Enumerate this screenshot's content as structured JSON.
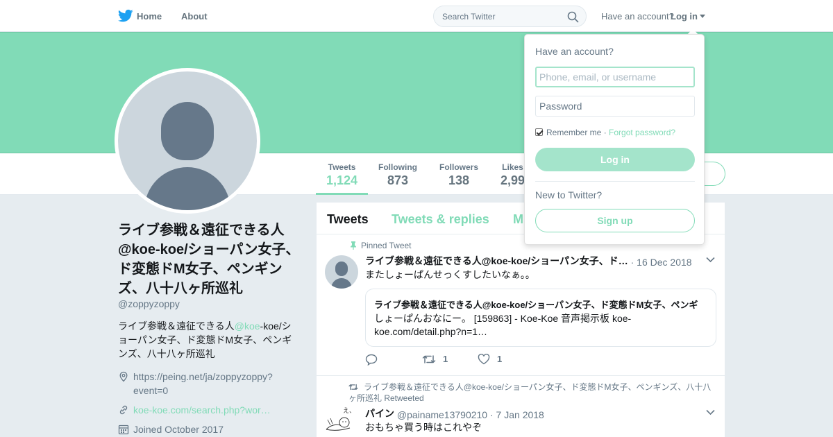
{
  "topnav": {
    "home_label": "Home",
    "about_label": "About",
    "search_placeholder": "Search Twitter",
    "have_account": "Have an account?",
    "login_label": "Log in"
  },
  "profile_nav": {
    "stats": [
      {
        "label": "Tweets",
        "value": "1,124"
      },
      {
        "label": "Following",
        "value": "873"
      },
      {
        "label": "Followers",
        "value": "138"
      },
      {
        "label": "Likes",
        "value": "2,99"
      }
    ]
  },
  "profile": {
    "name": "ライブ参戦＆遠征できる人@koe-koe/ショーパン女子、ド変態ドM女子、ペンギンズ、八十八ヶ所巡礼",
    "handle": "@zoppyzoppy",
    "bio_prefix": "ライブ参戦＆遠征できる人",
    "bio_mention": "@koe",
    "bio_suffix": "-koe/ショーパン女子、ド変態ドM女子、ペンギンズ、八十八ヶ所巡礼",
    "location": "https://peing.net/ja/zoppyzoppy?event=0",
    "website": "koe-koe.com/search.php?wor…",
    "joined": "Joined October 2017"
  },
  "timeline": {
    "tabs": [
      "Tweets",
      "Tweets & replies",
      "M"
    ],
    "pinned": {
      "pinned_label": "Pinned Tweet",
      "author": "ライブ参戦＆遠征できる人@koe-koe/ショーパン女子、ド…",
      "date": "· 16 Dec 2018",
      "text": "またしょーぱんせっくすしたいなぁ。。",
      "card_title": "ライブ参戦＆遠征できる人@koe-koe/ショーパン女子、ド変態ドM女子、ペンギ",
      "card_desc": "しょーぱんおなにー。 [159863] - Koe-Koe 音声掲示板 koe-koe.com/detail.php?n=1…",
      "retweets": "1",
      "likes": "1"
    },
    "retweet": {
      "rt_by": "ライブ参戦＆遠征できる人@koe-koe/ショーパン女子、ド変態ドM女子、ペンギンズ、八十八ヶ所巡礼 Retweeted",
      "author": "パイン",
      "handle": "@painame13790210",
      "date": "· 7 Jan 2018",
      "text": "おもちゃ買う時はこれやぞ"
    }
  },
  "login_dropdown": {
    "title": "Have an account?",
    "username_placeholder": "Phone, email, or username",
    "password_placeholder": "Password",
    "remember_label": "Remember me",
    "separator": " · ",
    "forgot_label": "Forgot password?",
    "login_button": "Log in",
    "new_label": "New to Twitter?",
    "signup_button": "Sign up"
  },
  "colors": {
    "accent": "#81dbb7",
    "muted": "#657786",
    "background": "#e6ecf0"
  }
}
